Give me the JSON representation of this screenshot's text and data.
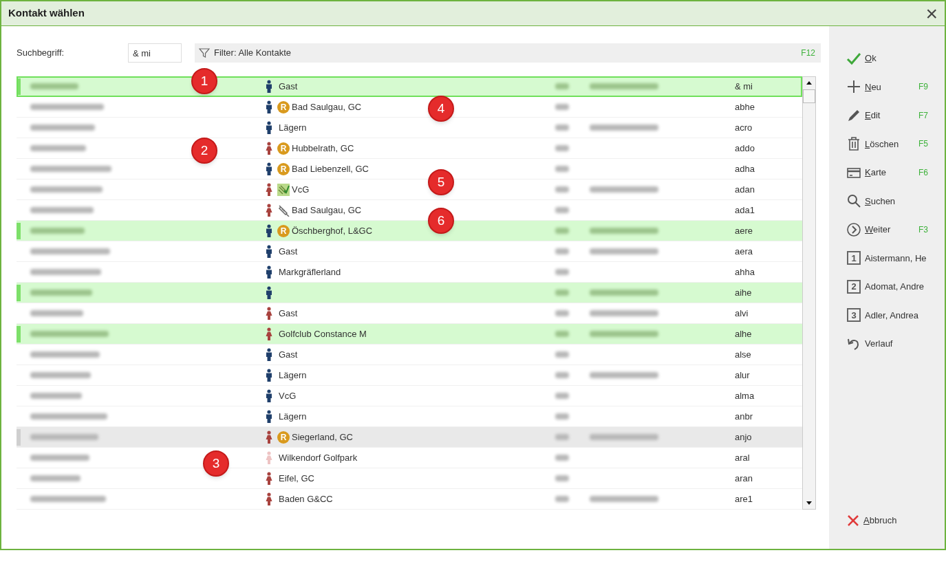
{
  "window": {
    "title": "Kontakt wählen",
    "close": "×"
  },
  "search": {
    "label": "Suchbegriff:",
    "value": "& mi"
  },
  "filter": {
    "label": "Filter: Alle Kontakte",
    "shortcut": "F12"
  },
  "rows": [
    {
      "female": false,
      "faded": false,
      "club": "Gast",
      "code": "& mi",
      "highlighted": true,
      "greyed": false,
      "selected": true
    },
    {
      "female": false,
      "faded": false,
      "badge": {
        "kind": "letter",
        "text": "R"
      },
      "club": "Bad Saulgau, GC",
      "code": "abhe",
      "highlighted": false,
      "greyed": false,
      "selected": false
    },
    {
      "female": false,
      "faded": false,
      "club": "Lägern",
      "code": "acro",
      "highlighted": false,
      "greyed": false,
      "selected": false
    },
    {
      "female": true,
      "faded": false,
      "badge": {
        "kind": "letter",
        "text": "R"
      },
      "club": "Hubbelrath, GC",
      "code": "addo",
      "highlighted": false,
      "greyed": false,
      "selected": false
    },
    {
      "female": false,
      "faded": false,
      "badge": {
        "kind": "letter",
        "text": "R"
      },
      "club": "Bad Liebenzell, GC",
      "code": "adha",
      "highlighted": false,
      "greyed": false,
      "selected": false
    },
    {
      "female": true,
      "faded": false,
      "badge": {
        "kind": "vcg"
      },
      "club": "VcG",
      "code": "adan",
      "highlighted": false,
      "greyed": false,
      "selected": false
    },
    {
      "female": true,
      "faded": false,
      "badge": {
        "kind": "syringe"
      },
      "club": "Bad Saulgau, GC",
      "code": "ada1",
      "highlighted": false,
      "greyed": false,
      "selected": false
    },
    {
      "female": false,
      "faded": false,
      "badge": {
        "kind": "letter",
        "text": "R"
      },
      "club": "Öschberghof, L&GC",
      "code": "aere",
      "highlighted": true,
      "greyed": false,
      "selected": false
    },
    {
      "female": false,
      "faded": false,
      "club": "Gast",
      "code": "aera",
      "highlighted": false,
      "greyed": false,
      "selected": false
    },
    {
      "female": false,
      "faded": false,
      "club": "Markgräflerland",
      "code": "ahha",
      "highlighted": false,
      "greyed": false,
      "selected": false
    },
    {
      "female": false,
      "faded": false,
      "code": "aihe",
      "highlighted": true,
      "greyed": false,
      "selected": false
    },
    {
      "female": true,
      "faded": false,
      "club": "Gast",
      "code": "alvi",
      "highlighted": false,
      "greyed": false,
      "selected": false
    },
    {
      "female": true,
      "faded": false,
      "club": "Golfclub Constance M",
      "code": "alhe",
      "highlighted": true,
      "greyed": false,
      "selected": false
    },
    {
      "female": false,
      "faded": false,
      "club": "Gast",
      "code": "alse",
      "highlighted": false,
      "greyed": false,
      "selected": false
    },
    {
      "female": false,
      "faded": false,
      "club": "Lägern",
      "code": "alur",
      "highlighted": false,
      "greyed": false,
      "selected": false
    },
    {
      "female": false,
      "faded": false,
      "club": "VcG",
      "code": "alma",
      "highlighted": false,
      "greyed": false,
      "selected": false
    },
    {
      "female": false,
      "faded": false,
      "club": "Lägern",
      "code": "anbr",
      "highlighted": false,
      "greyed": false,
      "selected": false
    },
    {
      "female": true,
      "faded": false,
      "badge": {
        "kind": "letter",
        "text": "R"
      },
      "club": "Siegerland, GC",
      "code": "anjo",
      "highlighted": false,
      "greyed": true,
      "selected": false
    },
    {
      "female": true,
      "faded": true,
      "club": "Wilkendorf Golfpark",
      "code": "aral",
      "highlighted": false,
      "greyed": false,
      "selected": false
    },
    {
      "female": true,
      "faded": false,
      "club": "Eifel, GC",
      "code": "aran",
      "highlighted": false,
      "greyed": false,
      "selected": false
    },
    {
      "female": true,
      "faded": false,
      "club": "Baden G&CC",
      "code": "are1",
      "highlighted": false,
      "greyed": false,
      "selected": false
    }
  ],
  "callouts": [
    "1",
    "2",
    "3",
    "4",
    "5",
    "6"
  ],
  "actions": [
    {
      "kind": "check",
      "label": "Ok",
      "accelerator": true
    },
    {
      "kind": "plus",
      "label": "Neu",
      "accelerator": true,
      "shortcut": "F9"
    },
    {
      "kind": "pencil",
      "label": "Edit",
      "accelerator": true,
      "shortcut": "F7"
    },
    {
      "kind": "trash",
      "label": "Löschen",
      "accelerator": true,
      "shortcut": "F5"
    },
    {
      "kind": "card",
      "label": "Karte",
      "accelerator": true,
      "shortcut": "F6"
    },
    {
      "kind": "search",
      "label": "Suchen",
      "accelerator": true
    },
    {
      "kind": "next",
      "label": "Weiter",
      "accelerator": true,
      "shortcut": "F3"
    },
    {
      "kind": "recent",
      "number": "1",
      "label": "Aistermann, He",
      "accelerator": false
    },
    {
      "kind": "recent",
      "number": "2",
      "label": "Adomat, Andre",
      "accelerator": false
    },
    {
      "kind": "recent",
      "number": "3",
      "label": "Adler, Andrea",
      "accelerator": false
    },
    {
      "kind": "undo",
      "label": "Verlauf",
      "accelerator": false
    }
  ],
  "cancel": {
    "label": "Abbruch",
    "accelerator": true
  }
}
